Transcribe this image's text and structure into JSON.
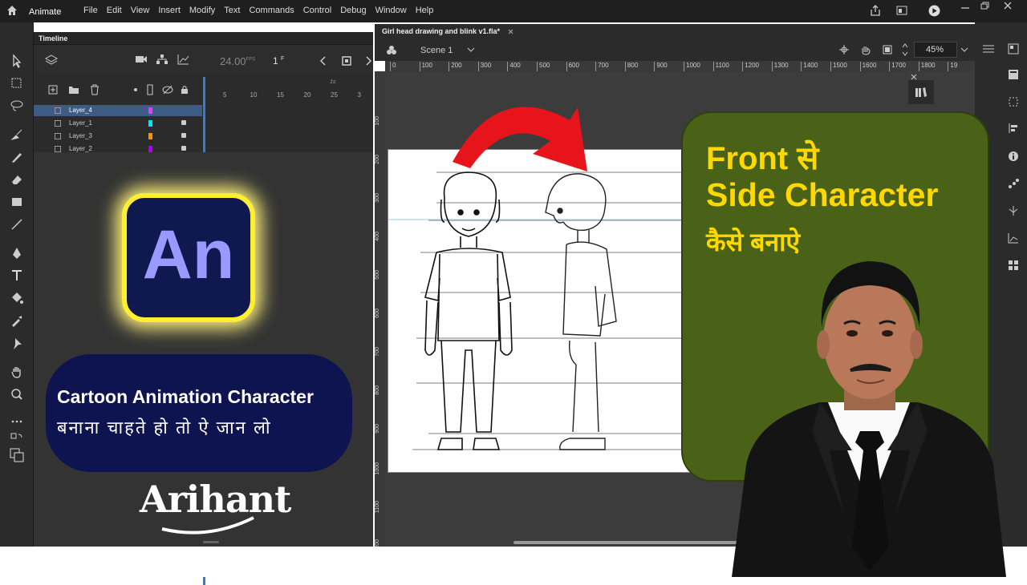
{
  "app": {
    "name": "Animate"
  },
  "menu": [
    "File",
    "Edit",
    "View",
    "Insert",
    "Modify",
    "Text",
    "Commands",
    "Control",
    "Debug",
    "Window",
    "Help"
  ],
  "timeline": {
    "tab_label": "Timeline",
    "fps": "24.00",
    "fps_unit": "FPS",
    "frame": "1",
    "frame_unit": "F",
    "ruler_ticks": [
      "5",
      "10",
      "15",
      "20",
      "25",
      "3"
    ],
    "ruler_sec": "1s",
    "layers": [
      {
        "name": "Layer_4",
        "selected": true,
        "color": "#e040fb",
        "locked": false
      },
      {
        "name": "Layer_1",
        "selected": false,
        "color": "#00e5ff",
        "locked": true
      },
      {
        "name": "Layer_3",
        "selected": false,
        "color": "#ff9100",
        "locked": true
      },
      {
        "name": "Layer_2",
        "selected": false,
        "color": "#aa00ff",
        "locked": true
      }
    ]
  },
  "document": {
    "tab_title": "Girl head drawing and blink v1.fla*",
    "scene": "Scene 1",
    "zoom": "45%",
    "ruler": [
      "0",
      "100",
      "200",
      "300",
      "400",
      "500",
      "600",
      "700",
      "800",
      "900",
      "1000",
      "1100",
      "1200",
      "1300",
      "1400",
      "1500",
      "1600",
      "1700",
      "1800",
      "19"
    ],
    "vruler": [
      "100",
      "200",
      "300",
      "400",
      "500",
      "600",
      "700",
      "800",
      "900",
      "1000",
      "1100",
      "1200"
    ]
  },
  "overlay": {
    "an_logo": "An",
    "pill_line1": "Cartoon Animation Character",
    "pill_line2": "बनाना चाहते हो तो ऐ जान लो",
    "brand": "Arihant",
    "front": "Front से",
    "side": "Side Character",
    "kaise": "कैसे बनाऐ"
  },
  "colors": {
    "accent_yellow": "#ffd800",
    "navy": "#0e1450",
    "green": "#4a6218",
    "arrow_red": "#e8141b"
  }
}
